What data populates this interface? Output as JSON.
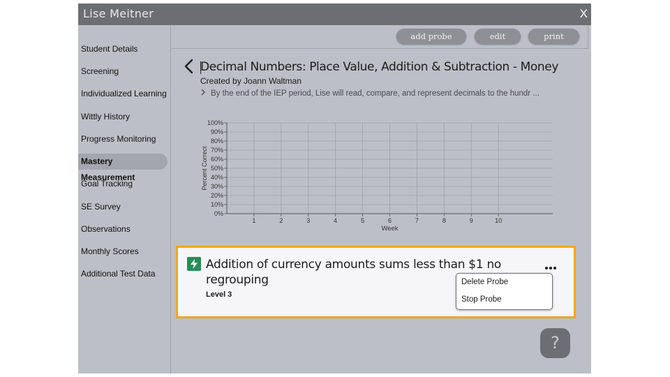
{
  "window": {
    "title": "Lise Meitner",
    "close_label": "X"
  },
  "sidebar": {
    "items": [
      {
        "label": "Student Details"
      },
      {
        "label": "Screening"
      },
      {
        "label": "Individualized Learning"
      },
      {
        "label": "Wittly History"
      },
      {
        "label": "Progress Monitoring"
      },
      {
        "label": "Mastery Measurement",
        "active": true
      },
      {
        "label": "Goal Tracking"
      },
      {
        "label": "SE Survey"
      },
      {
        "label": "Observations"
      },
      {
        "label": "Monthly Scores"
      },
      {
        "label": "Additional Test Data"
      }
    ]
  },
  "toolbar": {
    "add_probe_label": "add probe",
    "edit_label": "edit",
    "print_label": "print"
  },
  "probe": {
    "title": "Decimal Numbers: Place Value, Addition & Subtraction - Money",
    "created_by": "Created by Joann Waltman",
    "goal_text": "By the end of the IEP period, Lise will read, compare, and represent decimals to the hundr ..."
  },
  "chart_data": {
    "type": "line",
    "xlabel": "Week",
    "ylabel": "Percent Correct",
    "x_ticks": [
      1,
      2,
      3,
      4,
      5,
      6,
      7,
      8,
      9,
      10
    ],
    "y_ticks": [
      "0%",
      "10%",
      "20%",
      "30%",
      "40%",
      "50%",
      "60%",
      "70%",
      "80%",
      "90%",
      "100%"
    ],
    "ylim": [
      0,
      100
    ],
    "xlim": [
      0,
      12
    ],
    "grid": true,
    "series": []
  },
  "card": {
    "title": "Addition of currency amounts sums less than $1 no regrouping",
    "level": "Level 3",
    "icon": "bolt-icon",
    "accent_color": "#f1a523",
    "icon_color": "#2a8b57",
    "menu": {
      "items": [
        "Delete Probe",
        "Stop Probe"
      ]
    }
  },
  "help": {
    "label": "?"
  }
}
